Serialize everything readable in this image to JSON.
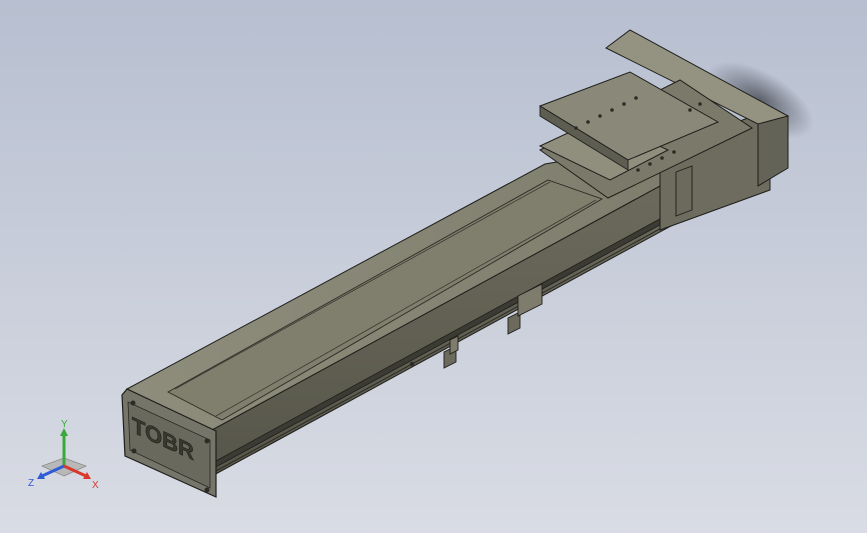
{
  "viewport": {
    "background_top": "#b7bfd0",
    "background_bottom": "#d9dce4"
  },
  "model": {
    "body_color": "#8b8a79",
    "body_dark": "#5d5c50",
    "body_light": "#a3a292",
    "edge_color": "#1e1e1a",
    "end_plate_logo": "TOBR"
  },
  "triad": {
    "x_label": "X",
    "y_label": "Y",
    "z_label": "Z",
    "x_color": "#d9382c",
    "y_color": "#3aa83a",
    "z_color": "#2f5bd8"
  }
}
